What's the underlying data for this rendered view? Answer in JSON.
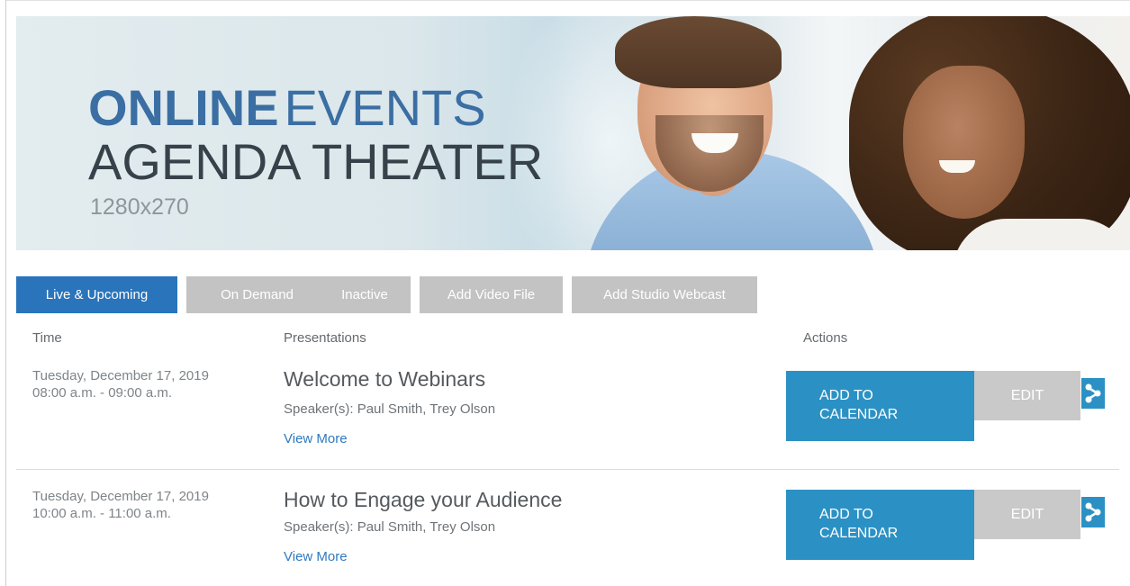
{
  "banner": {
    "title_bold": "ONLINE",
    "title_light": "EVENTS",
    "subtitle": "AGENDA THEATER",
    "size_note": "1280x270"
  },
  "tabs": [
    {
      "label": "Live & Upcoming",
      "active": true
    },
    {
      "label": "On Demand",
      "active": false
    },
    {
      "label": "Inactive",
      "active": false
    },
    {
      "label": "Add Video File",
      "active": false
    },
    {
      "label": "Add Studio Webcast",
      "active": false
    }
  ],
  "columns": {
    "time": "Time",
    "presentations": "Presentations",
    "actions": "Actions"
  },
  "events": [
    {
      "date": "Tuesday, December 17, 2019",
      "time": "08:00 a.m. - 09:00 a.m.",
      "title": "Welcome to Webinars",
      "speakers": "Speaker(s): Paul Smith, Trey Olson",
      "view_more": "View More",
      "add_calendar_line1": "ADD TO",
      "add_calendar_line2": "CALENDAR",
      "edit": "EDIT"
    },
    {
      "date": "Tuesday, December 17, 2019",
      "time": "10:00 a.m. - 11:00 a.m.",
      "title": "How to Engage your Audience",
      "speakers": "Speaker(s): Paul Smith, Trey Olson",
      "view_more": "View More",
      "add_calendar_line1": "ADD TO",
      "add_calendar_line2": "CALENDAR",
      "edit": "EDIT"
    }
  ],
  "colors": {
    "tab_active": "#2a74bb",
    "tab_inactive": "#c3c3c3",
    "calendar_button": "#2b91c4",
    "edit_button": "#c9c9c9",
    "link": "#2f79c0",
    "title_blue": "#3b6fa3"
  },
  "icons": {
    "share": "share-icon"
  }
}
